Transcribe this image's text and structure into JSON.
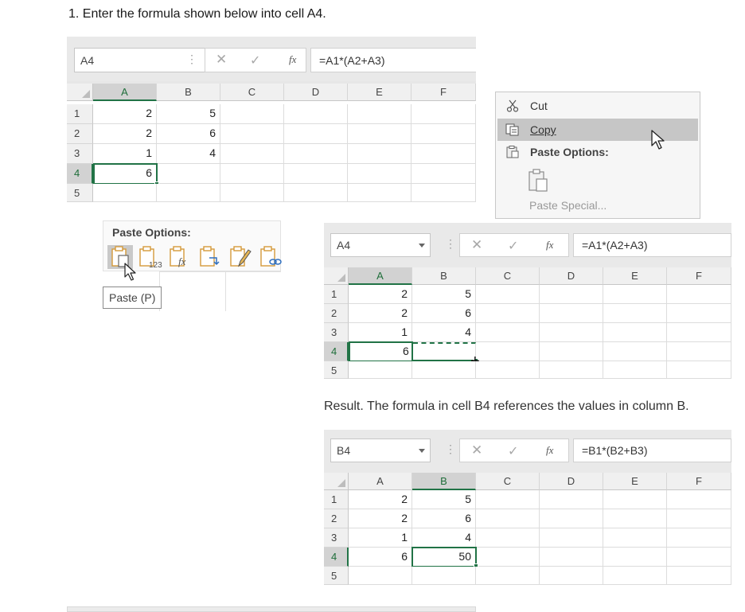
{
  "instruction": "1. Enter the formula shown below into cell A4.",
  "excel1": {
    "namebox": "A4",
    "formula": "=A1*(A2+A3)",
    "columns": [
      "A",
      "B",
      "C",
      "D",
      "E",
      "F"
    ],
    "rows": [
      "1",
      "2",
      "3",
      "4",
      "5"
    ],
    "cells": [
      [
        "2",
        "5"
      ],
      [
        "2",
        "6"
      ],
      [
        "1",
        "4"
      ],
      [
        "6",
        ""
      ]
    ]
  },
  "context_menu": {
    "cut": "Cut",
    "copy": "Copy",
    "paste_options": "Paste Options:",
    "paste_special": "Paste Special..."
  },
  "paste_options_panel": {
    "title": "Paste Options:",
    "icons": [
      "paste-icon",
      "paste-values-icon",
      "paste-formulas-icon",
      "paste-transpose-icon",
      "paste-formatting-icon",
      "paste-link-icon"
    ],
    "tooltip": "Paste (P)"
  },
  "excel2": {
    "namebox": "A4",
    "formula": "=A1*(A2+A3)",
    "columns": [
      "A",
      "B",
      "C",
      "D",
      "E",
      "F"
    ],
    "rows": [
      "1",
      "2",
      "3",
      "4",
      "5"
    ],
    "cells": [
      [
        "2",
        "5"
      ],
      [
        "2",
        "6"
      ],
      [
        "1",
        "4"
      ],
      [
        "6",
        ""
      ]
    ]
  },
  "result_text": "Result. The formula in cell B4 references the values in column B.",
  "excel3": {
    "namebox": "B4",
    "formula": "=B1*(B2+B3)",
    "columns": [
      "A",
      "B",
      "C",
      "D",
      "E",
      "F"
    ],
    "rows": [
      "1",
      "2",
      "3",
      "4",
      "5"
    ],
    "cells": [
      [
        "2",
        "5"
      ],
      [
        "2",
        "6"
      ],
      [
        "1",
        "4"
      ],
      [
        "6",
        "50"
      ]
    ]
  },
  "colors": {
    "excel_green": "#217346",
    "paste_orange": "#d49a3a"
  }
}
